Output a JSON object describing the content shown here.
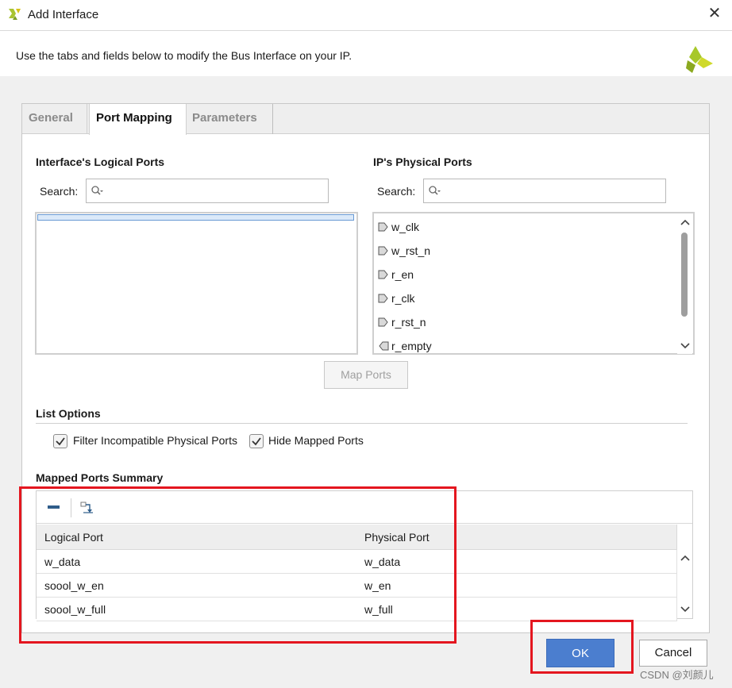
{
  "window": {
    "title": "Add Interface",
    "close_glyph": "✕"
  },
  "header": {
    "description": "Use the tabs and fields below to modify the Bus Interface on your IP."
  },
  "tabs": [
    {
      "label": "General",
      "active": false
    },
    {
      "label": "Port Mapping",
      "active": true
    },
    {
      "label": "Parameters",
      "active": false
    }
  ],
  "logical_ports": {
    "title": "Interface's Logical Ports",
    "search_label": "Search:",
    "search_value": "",
    "items": []
  },
  "physical_ports": {
    "title": "IP's Physical Ports",
    "search_label": "Search:",
    "search_value": "",
    "items": [
      {
        "name": "w_clk",
        "direction": "in"
      },
      {
        "name": "w_rst_n",
        "direction": "in"
      },
      {
        "name": "r_en",
        "direction": "in"
      },
      {
        "name": "r_clk",
        "direction": "in"
      },
      {
        "name": "r_rst_n",
        "direction": "in"
      },
      {
        "name": "r_empty",
        "direction": "out"
      }
    ]
  },
  "map_ports_label": "Map Ports",
  "list_options": {
    "title": "List Options",
    "filter_incompatible": {
      "label": "Filter Incompatible Physical Ports",
      "checked": true
    },
    "hide_mapped": {
      "label": "Hide Mapped Ports",
      "checked": true
    }
  },
  "summary": {
    "title": "Mapped Ports Summary",
    "columns": [
      "Logical Port",
      "Physical Port"
    ],
    "rows": [
      [
        "w_data",
        "w_data"
      ],
      [
        "soool_w_en",
        "w_en"
      ],
      [
        "soool_w_full",
        "w_full"
      ]
    ]
  },
  "buttons": {
    "ok": "OK",
    "cancel": "Cancel"
  },
  "watermark": "CSDN @刘颜儿",
  "colors": {
    "accent_blue": "#4b7ecf",
    "highlight_red": "#e4161f",
    "xilinx_green": "#a7c82a"
  }
}
